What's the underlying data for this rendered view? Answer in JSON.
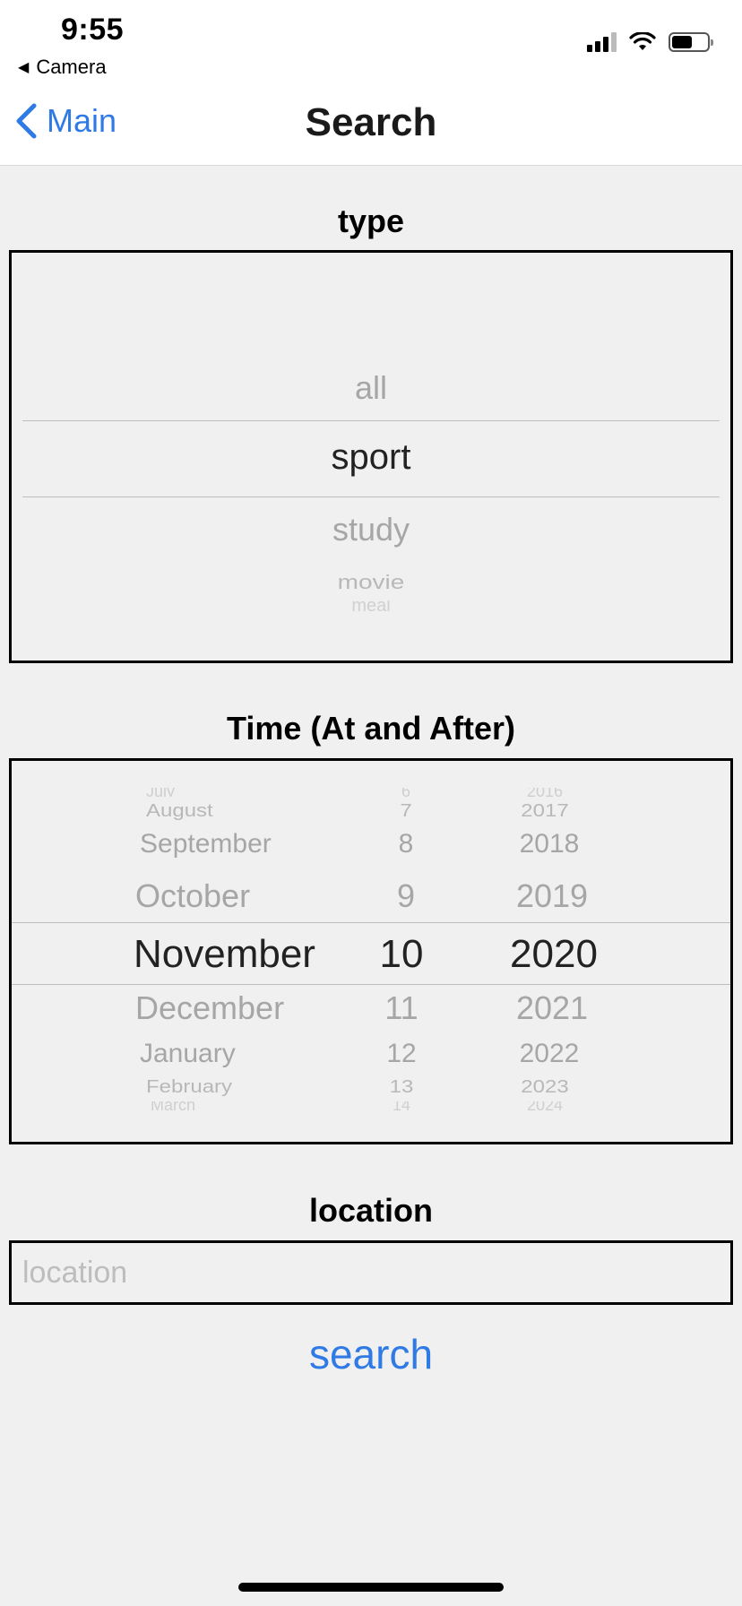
{
  "status_bar": {
    "time": "9:55",
    "back_app": "Camera"
  },
  "nav": {
    "back_label": "Main",
    "title": "Search"
  },
  "type_picker": {
    "label": "type",
    "items": [
      {
        "text": "all"
      },
      {
        "text": "sport"
      },
      {
        "text": "study"
      },
      {
        "text": "movie"
      },
      {
        "text": "meal"
      }
    ],
    "selected": "sport"
  },
  "time_picker": {
    "label": "Time (At and After)",
    "months": [
      "July",
      "August",
      "September",
      "October",
      "November",
      "December",
      "January",
      "February",
      "March"
    ],
    "days": [
      "6",
      "7",
      "8",
      "9",
      "10",
      "11",
      "12",
      "13",
      "14"
    ],
    "years": [
      "2016",
      "2017",
      "2018",
      "2019",
      "2020",
      "2021",
      "2022",
      "2023",
      "2024"
    ],
    "selected": {
      "month": "November",
      "day": "10",
      "year": "2020"
    }
  },
  "location": {
    "label": "location",
    "placeholder": "location",
    "value": ""
  },
  "search_button": {
    "label": "search"
  },
  "colors": {
    "accent": "#2f7ae5",
    "background": "#f0f0f0",
    "picker_dim": "#a6a6a6",
    "picker_selected": "#222222"
  }
}
